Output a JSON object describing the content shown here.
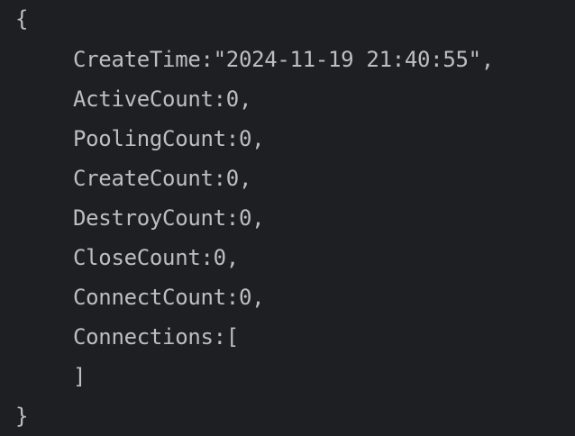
{
  "code": {
    "lines": [
      "{",
      "CreateTime:\"2024-11-19 21:40:55\",",
      "ActiveCount:0,",
      "PoolingCount:0,",
      "CreateCount:0,",
      "DestroyCount:0,",
      "CloseCount:0,",
      "ConnectCount:0,",
      "Connections:[",
      "]",
      "}"
    ]
  }
}
